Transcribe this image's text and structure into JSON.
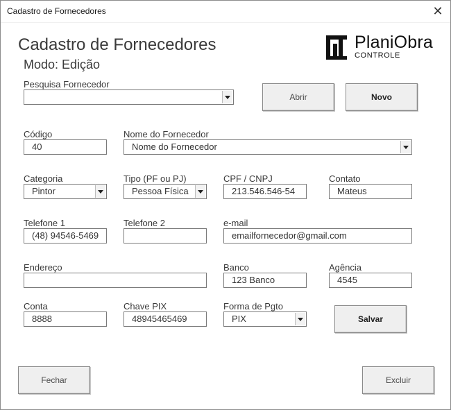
{
  "window": {
    "title": "Cadastro de Fornecedores"
  },
  "header": {
    "title": "Cadastro de Fornecedores",
    "mode": "Modo: Edição"
  },
  "logo": {
    "name": "PlaniObra",
    "subtitle": "CONTROLE"
  },
  "search": {
    "label": "Pesquisa Fornecedor",
    "value": ""
  },
  "buttons": {
    "open": "Abrir",
    "new": "Novo",
    "save": "Salvar",
    "close": "Fechar",
    "delete": "Excluir"
  },
  "fields": {
    "codigo": {
      "label": "Código",
      "value": "40"
    },
    "nome": {
      "label": "Nome do Fornecedor",
      "value": "Nome do Fornecedor"
    },
    "categoria": {
      "label": "Categoria",
      "value": "Pintor"
    },
    "tipo": {
      "label": "Tipo (PF ou PJ)",
      "value": "Pessoa Física"
    },
    "cpf": {
      "label": "CPF / CNPJ",
      "value": "213.546.546-54"
    },
    "contato": {
      "label": "Contato",
      "value": "Mateus"
    },
    "telefone1": {
      "label": "Telefone 1",
      "value": "(48) 94546-5469"
    },
    "telefone2": {
      "label": "Telefone 2",
      "value": ""
    },
    "email": {
      "label": "e-mail",
      "value": "emailfornecedor@gmail.com"
    },
    "endereco": {
      "label": "Endereço",
      "value": ""
    },
    "banco": {
      "label": "Banco",
      "value": "123 Banco"
    },
    "agencia": {
      "label": "Agência",
      "value": "4545"
    },
    "conta": {
      "label": "Conta",
      "value": "8888"
    },
    "pix": {
      "label": "Chave PIX",
      "value": "48945465469"
    },
    "pagamento": {
      "label": "Forma de Pgto",
      "value": "PIX"
    }
  }
}
